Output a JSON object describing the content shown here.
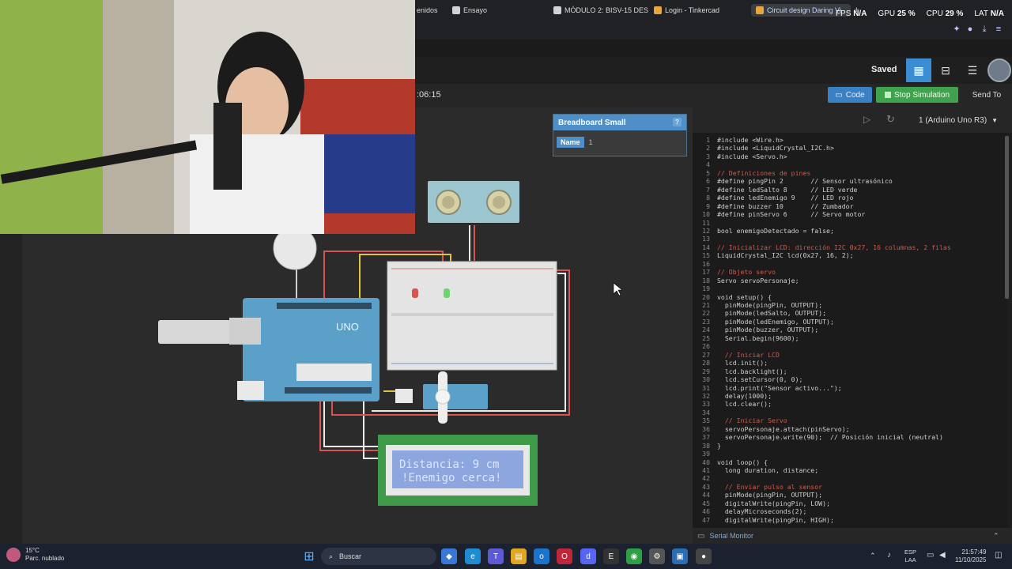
{
  "browser": {
    "tabs": [
      {
        "label": "enidos",
        "color": "#2a2a2a"
      },
      {
        "label": "Ensayo",
        "color": "#cfd2d6"
      },
      {
        "label": "MÓDULO 2: BISV-15 DES",
        "color": "#cfd2d6"
      },
      {
        "label": "Login - Tinkercad",
        "color": "#e8a53d"
      },
      {
        "label": "Circuit design Daring Vi",
        "color": "#e8a53d",
        "active": true
      }
    ],
    "new_tab": "+"
  },
  "overlay": {
    "fps_label": "FPS",
    "fps_value": "N/A",
    "gpu_label": "GPU",
    "gpu_value": "25 %",
    "cpu_label": "CPU",
    "cpu_value": "29 %",
    "lat_label": "LAT",
    "lat_value": "N/A"
  },
  "header": {
    "saved": "Saved",
    "views": [
      "circuit-view-icon",
      "schematic-view-icon",
      "component-list-icon"
    ]
  },
  "sim_toolbar": {
    "timer": ":06:15",
    "code_label": "Code",
    "stop_label": "Stop Simulation",
    "send_label": "Send To"
  },
  "inspector": {
    "title": "Breadboard Small",
    "help": "?",
    "name_label": "Name",
    "name_value": "1"
  },
  "code_panel": {
    "board": "1 (Arduino Uno R3)",
    "lines": [
      {
        "n": "1",
        "t": "#include <Wire.h>"
      },
      {
        "n": "2",
        "t": "#include <LiquidCrystal_I2C.h>"
      },
      {
        "n": "3",
        "t": "#include <Servo.h>"
      },
      {
        "n": "4",
        "t": ""
      },
      {
        "n": "5",
        "t": "// Definiciones de pines",
        "c": "cmt"
      },
      {
        "n": "6",
        "t": "#define pingPin 2       // Sensor ultrasónico"
      },
      {
        "n": "7",
        "t": "#define ledSalto 8      // LED verde"
      },
      {
        "n": "8",
        "t": "#define ledEnemigo 9    // LED rojo"
      },
      {
        "n": "9",
        "t": "#define buzzer 10       // Zumbador"
      },
      {
        "n": "10",
        "t": "#define pinServo 6      // Servo motor"
      },
      {
        "n": "11",
        "t": ""
      },
      {
        "n": "12",
        "t": "bool enemigoDetectado = false;"
      },
      {
        "n": "13",
        "t": ""
      },
      {
        "n": "14",
        "t": "// Inicializar LCD: dirección I2C 0x27, 16 columnas, 2 filas",
        "c": "cmt"
      },
      {
        "n": "15",
        "t": "LiquidCrystal_I2C lcd(0x27, 16, 2);"
      },
      {
        "n": "16",
        "t": ""
      },
      {
        "n": "17",
        "t": "// Objeto servo",
        "c": "cmt"
      },
      {
        "n": "18",
        "t": "Servo servoPersonaje;"
      },
      {
        "n": "19",
        "t": ""
      },
      {
        "n": "20",
        "t": "void setup() {"
      },
      {
        "n": "21",
        "t": "  pinMode(pingPin, OUTPUT);"
      },
      {
        "n": "22",
        "t": "  pinMode(ledSalto, OUTPUT);"
      },
      {
        "n": "23",
        "t": "  pinMode(ledEnemigo, OUTPUT);"
      },
      {
        "n": "24",
        "t": "  pinMode(buzzer, OUTPUT);"
      },
      {
        "n": "25",
        "t": "  Serial.begin(9600);"
      },
      {
        "n": "26",
        "t": ""
      },
      {
        "n": "27",
        "t": "  // Iniciar LCD",
        "c": "cmt"
      },
      {
        "n": "28",
        "t": "  lcd.init();"
      },
      {
        "n": "29",
        "t": "  lcd.backlight();"
      },
      {
        "n": "30",
        "t": "  lcd.setCursor(0, 0);"
      },
      {
        "n": "31",
        "t": "  lcd.print(\"Sensor activo...\");"
      },
      {
        "n": "32",
        "t": "  delay(1000);"
      },
      {
        "n": "33",
        "t": "  lcd.clear();"
      },
      {
        "n": "34",
        "t": ""
      },
      {
        "n": "35",
        "t": "  // Iniciar Servo",
        "c": "cmt"
      },
      {
        "n": "36",
        "t": "  servoPersonaje.attach(pinServo);"
      },
      {
        "n": "37",
        "t": "  servoPersonaje.write(90);  // Posición inicial (neutral)"
      },
      {
        "n": "38",
        "t": "}"
      },
      {
        "n": "39",
        "t": ""
      },
      {
        "n": "40",
        "t": "void loop() {"
      },
      {
        "n": "41",
        "t": "  long duration, distance;"
      },
      {
        "n": "42",
        "t": ""
      },
      {
        "n": "43",
        "t": "  // Enviar pulso al sensor",
        "c": "cmt"
      },
      {
        "n": "44",
        "t": "  pinMode(pingPin, OUTPUT);"
      },
      {
        "n": "45",
        "t": "  digitalWrite(pingPin, LOW);"
      },
      {
        "n": "46",
        "t": "  delayMicroseconds(2);"
      },
      {
        "n": "47",
        "t": "  digitalWrite(pingPin, HIGH);"
      }
    ],
    "serial_monitor": "Serial Monitor"
  },
  "circuit": {
    "lcd_line1": "Distancia:  9 cm",
    "lcd_line2": "!Enemigo cerca!",
    "arduino_label": "UNO"
  },
  "taskbar": {
    "weather_temp": "15°C",
    "weather_desc": "Parc. nublado",
    "search_placeholder": "Buscar",
    "lang_top": "ESP",
    "lang_bottom": "LAA",
    "time": "21:57:49",
    "date": "11/10/2025"
  },
  "colors": {
    "accent_blue": "#3b7fc4",
    "sim_green": "#3fa34d",
    "lcd_bg": "#8ea6e0",
    "lcd_frame": "#3f9b4a"
  }
}
